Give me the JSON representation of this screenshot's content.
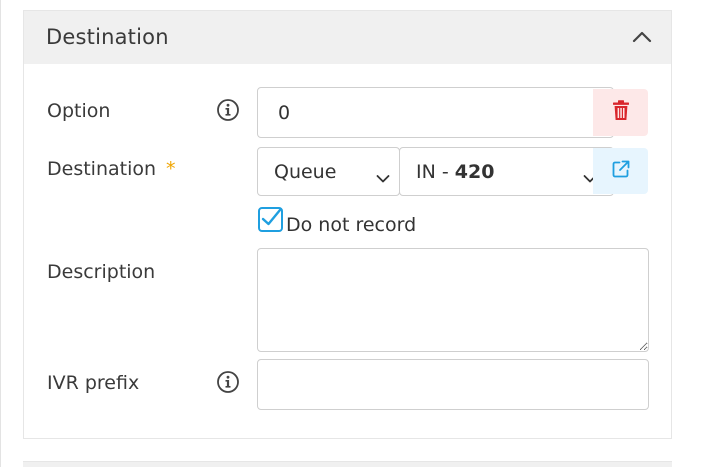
{
  "panel": {
    "title": "Destination"
  },
  "form": {
    "option": {
      "label": "Option",
      "value": "0"
    },
    "destination": {
      "label": "Destination",
      "required_mark": "*",
      "type_value": "Queue",
      "target_prefix": "IN - ",
      "target_number": "420"
    },
    "do_not_record": {
      "label": "Do not record",
      "checked": true
    },
    "description": {
      "label": "Description",
      "value": ""
    },
    "ivr_prefix": {
      "label": "IVR prefix",
      "value": ""
    }
  },
  "icons": {
    "collapse": "chevron-up-icon",
    "info": "info-icon",
    "delete": "trash-icon",
    "open": "external-link-icon",
    "dropdown": "chevron-down-icon",
    "check": "checkmark-icon"
  },
  "colors": {
    "required": "#f0a500",
    "delete_icon": "#d9262c",
    "delete_bg": "#fde8e8",
    "open_icon": "#1f9fe0",
    "open_bg": "#e7f5fe",
    "checkbox": "#1f9fe0",
    "header_bg": "#f0f0f0"
  }
}
